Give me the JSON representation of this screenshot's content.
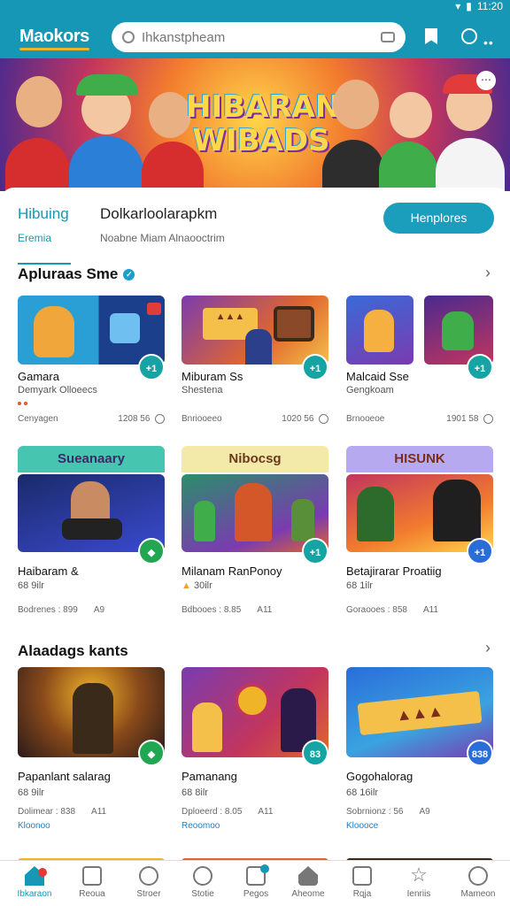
{
  "header": {
    "logo": "Maokors",
    "search_placeholder": "Ihkanstpheam",
    "status_time": "11:20",
    "colors": {
      "primary": "#1597b5",
      "accent": "#f0b429"
    }
  },
  "banner": {
    "title_line1": "HIBARAN",
    "title_line2": "WIBADS"
  },
  "tabs": {
    "active_label": "Hibuing",
    "active_sub": "Eremia",
    "second_label": "Dolkarloolarapkm",
    "second_sub": "Noabne Miam Alnaooctrim",
    "cta_label": "Henplores"
  },
  "section1": {
    "title": "Apluraas Sme",
    "cards": [
      {
        "title": "Gamara",
        "sub": "Demyark Olloeecs",
        "meta_left": "Cenyagen",
        "meta_right": "1208 56",
        "badge": "+1"
      },
      {
        "title": "Miburam Ss",
        "sub": "Shestena",
        "meta_left": "Bnriooeeo",
        "meta_right": "1020 56",
        "badge": "+1"
      },
      {
        "title": "Malcaid Sse",
        "sub": "Gengkoam",
        "meta_left": "Brnooeoe",
        "meta_right": "1901 58",
        "badge": "+1"
      }
    ]
  },
  "section2": {
    "cards": [
      {
        "banner": "Sueanaary",
        "title": "Haibaram &",
        "sub": "68 9ilr",
        "meta_left": "Bodrenes : 899",
        "meta_right": "A9"
      },
      {
        "banner": "Nibocsg",
        "title": "Milanam RanPonoy",
        "sub": "30ilr",
        "meta_left": "Bdbooes : 8.85",
        "meta_right": "A11",
        "badge": "+1"
      },
      {
        "banner": "HISUNK",
        "title": "Betajirarar Proatiig",
        "sub": "68 1ilr",
        "meta_left": "Goraooes : 858",
        "meta_right": "A11",
        "badge": "+1"
      }
    ]
  },
  "section3": {
    "title": "Alaadags kants",
    "cards": [
      {
        "title": "Papanlant salarag",
        "sub": "68 9ilr",
        "meta_left": "Dolimear : 838",
        "meta_right": "A11",
        "link": "Kloonoo"
      },
      {
        "title": "Pamanang",
        "sub": "68 8ilr",
        "meta_left": "Dploeerd : 8.05",
        "meta_right": "A11",
        "link": "Reoomoo",
        "badge": "83"
      },
      {
        "title": "Gogohalorag",
        "sub": "68 16ilr",
        "meta_left": "Sobrnionz : 56",
        "meta_right": "A9",
        "link": "Kloooce",
        "badge": "838"
      }
    ]
  },
  "nav": [
    {
      "label": "Ibkaraon"
    },
    {
      "label": "Reoua"
    },
    {
      "label": "Stroer"
    },
    {
      "label": "Stotie"
    },
    {
      "label": "Pegos"
    },
    {
      "label": "Aheome"
    },
    {
      "label": "Rqja"
    },
    {
      "label": "Ienriis"
    },
    {
      "label": "Mameon"
    }
  ]
}
